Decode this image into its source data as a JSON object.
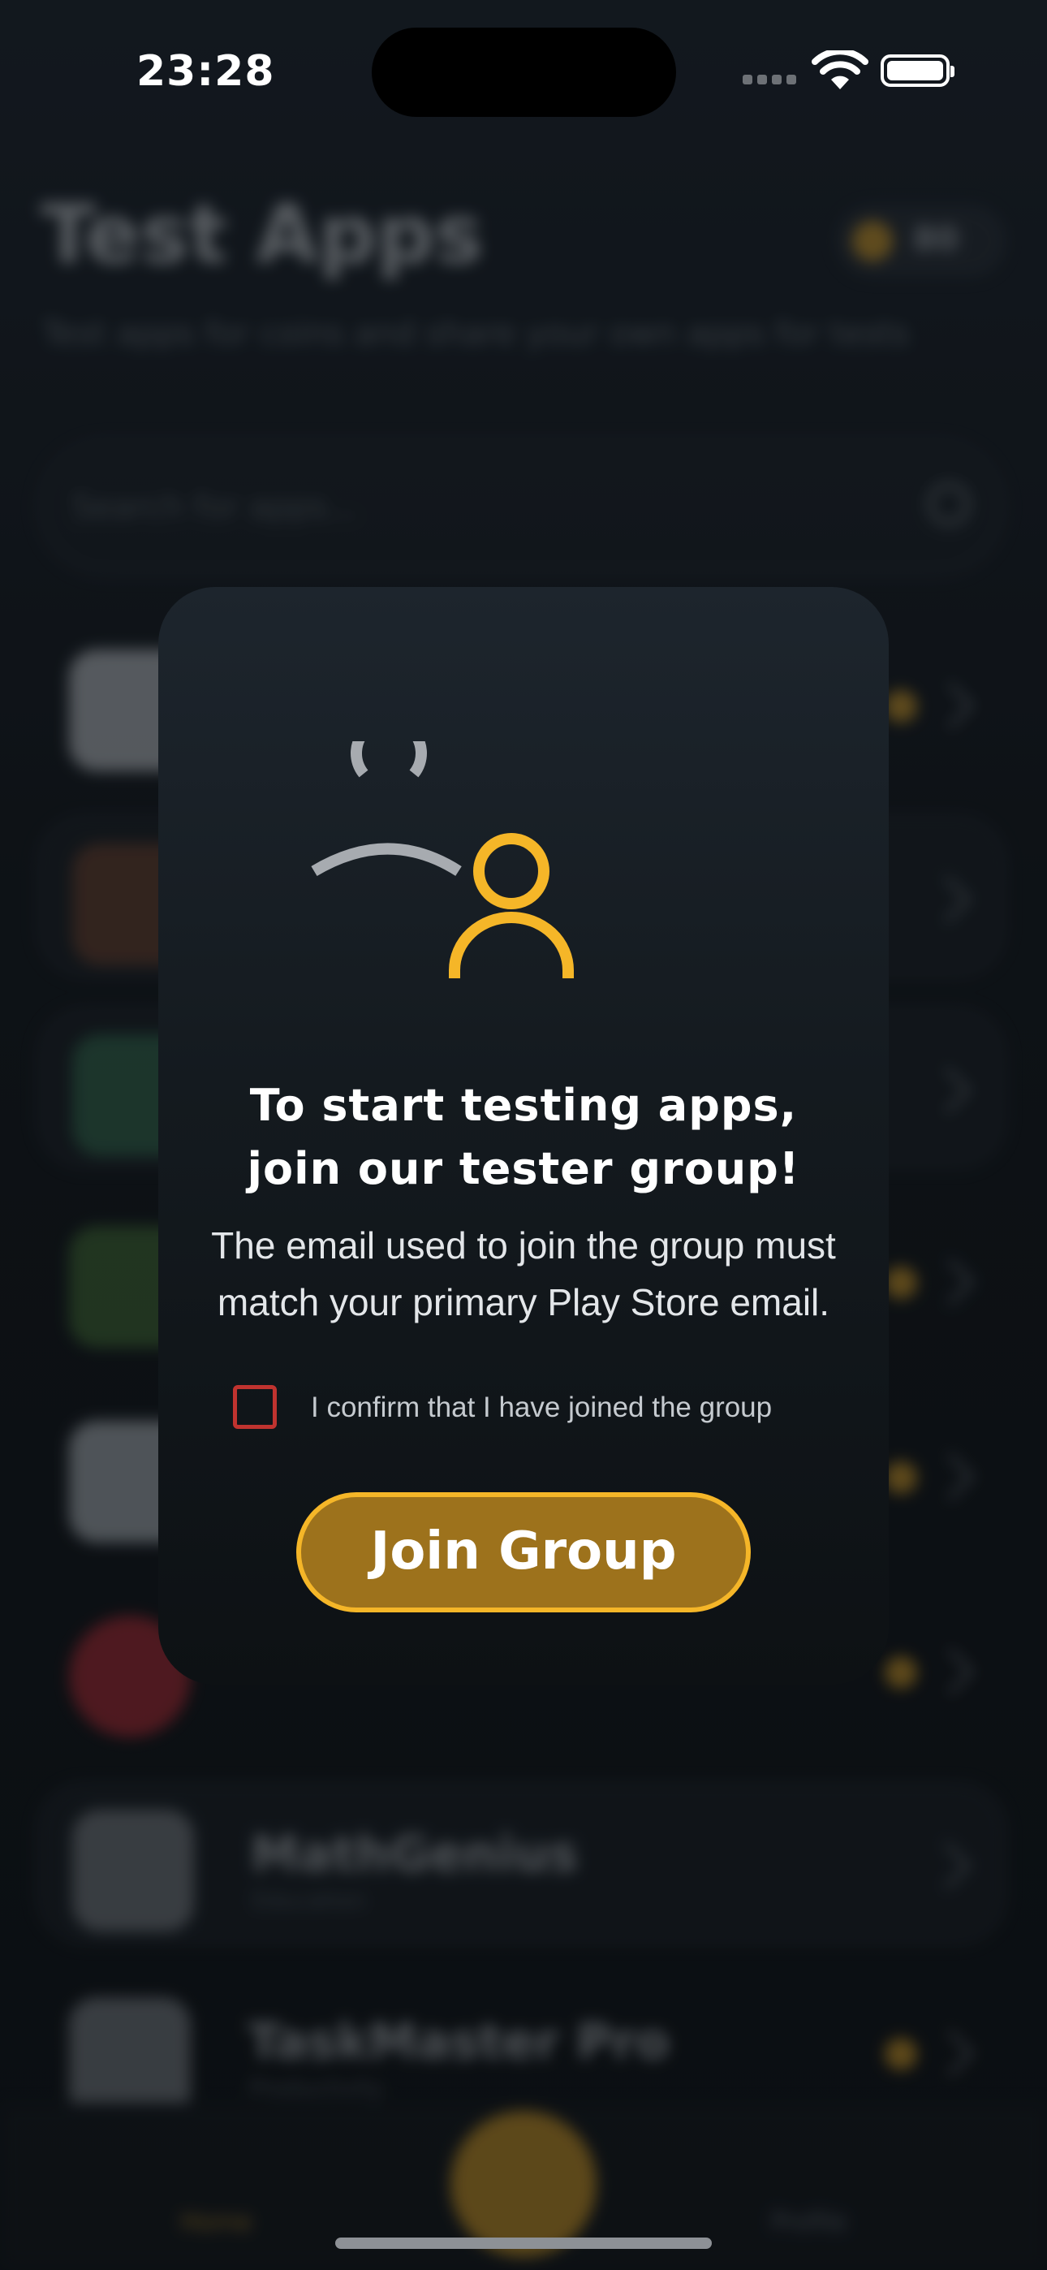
{
  "status_bar": {
    "time": "23:28"
  },
  "background": {
    "title": "Test Apps",
    "subtitle": "Test apps for coins and share your own apps for tests",
    "coins": "80",
    "search_placeholder": "Search for apps...",
    "apps": [
      {
        "name": "",
        "sub": ""
      },
      {
        "name": "",
        "sub": ""
      },
      {
        "name": "",
        "sub": ""
      },
      {
        "name": "",
        "sub": ""
      },
      {
        "name": "",
        "sub": ""
      },
      {
        "name": "",
        "sub": ""
      },
      {
        "name": "MathGenius",
        "sub": "Education"
      },
      {
        "name": "TaskMaster Pro",
        "sub": "Productivity"
      }
    ],
    "tabs": {
      "home": "Home",
      "profile": "Profile"
    }
  },
  "modal": {
    "title": "To start testing apps, join our tester group!",
    "description": "The email used to join the group must match your primary Play Store email.",
    "confirm_label": "I confirm that I have joined the group",
    "confirm_checked": false,
    "join_button": "Join Group"
  },
  "colors": {
    "accent": "#f5b628",
    "button_fill": "#9d721c",
    "checkbox_border": "#c0332f",
    "modal_bg": "#141a1f"
  },
  "icons": {
    "illustration": "group-users-icon",
    "wifi": "wifi-icon",
    "battery": "battery-icon",
    "signal": "cellular-signal-icon"
  }
}
